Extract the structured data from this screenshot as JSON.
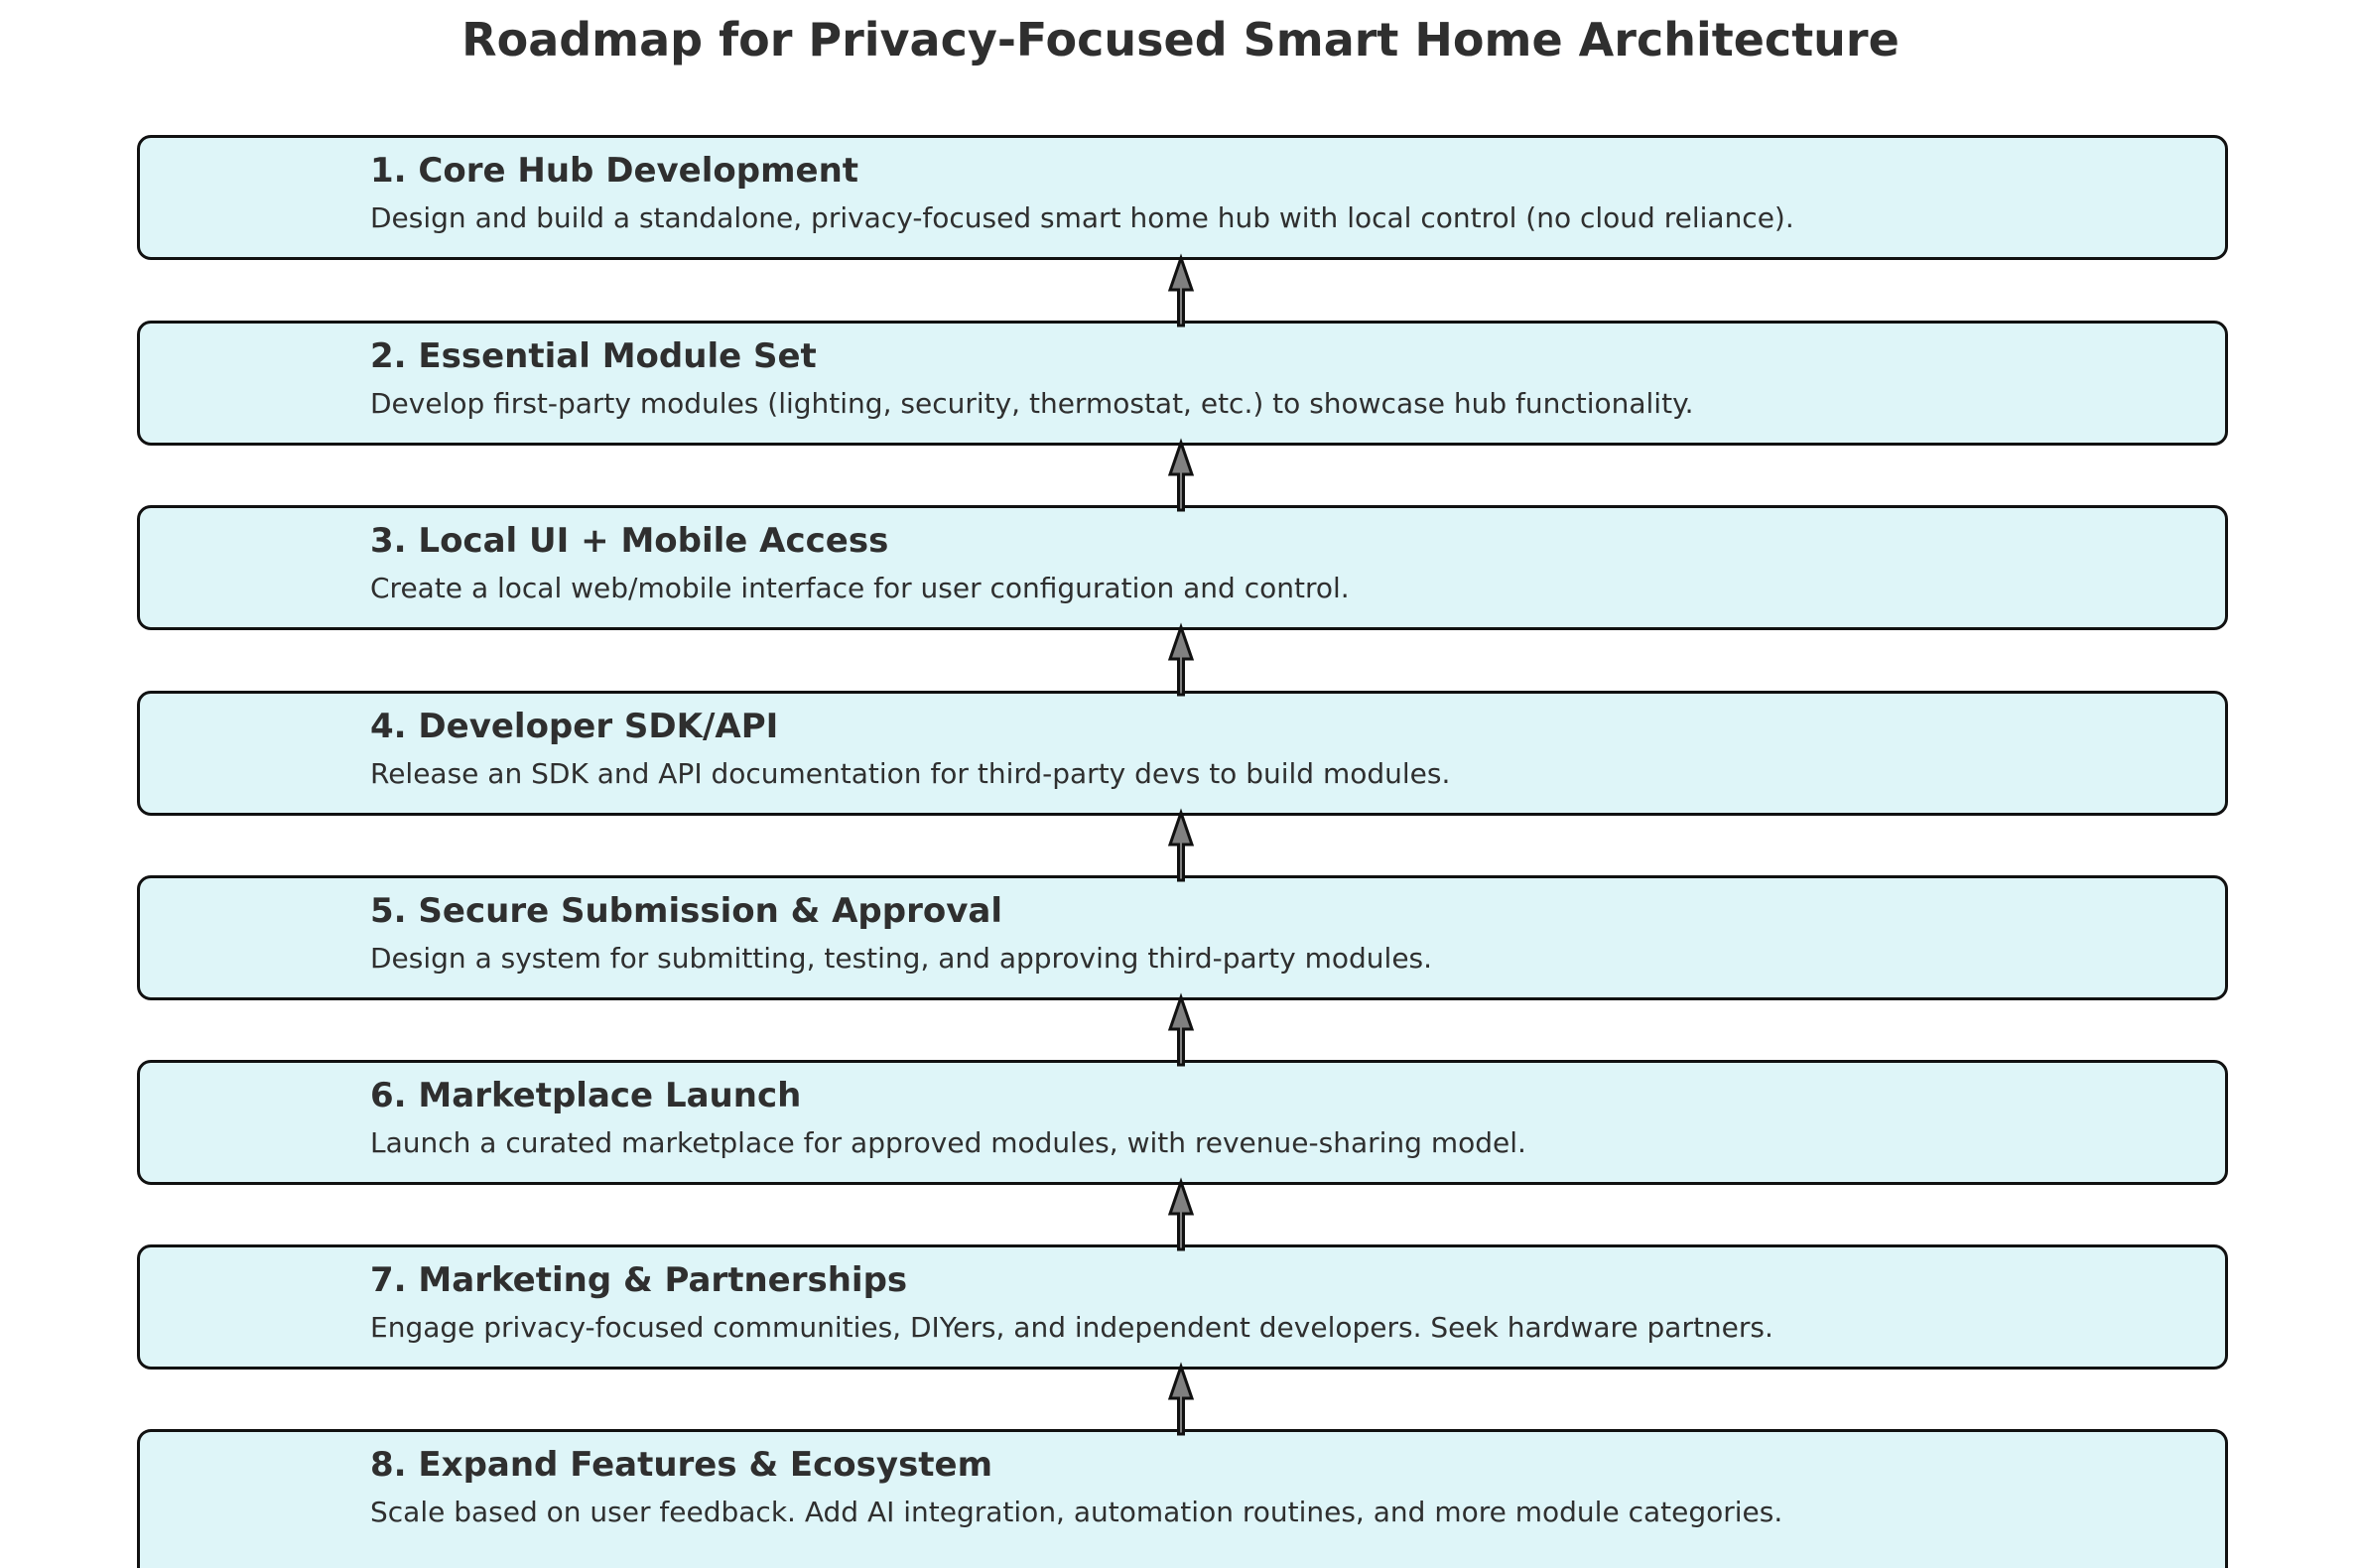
{
  "title": "Roadmap for Privacy-Focused Smart Home Architecture",
  "colors": {
    "box_fill": "#def5f8",
    "box_border": "#111111",
    "arrow_fill": "#808080",
    "text": "#2f2f2f"
  },
  "steps": [
    {
      "title": "1. Core Hub Development",
      "description": "Design and build a standalone, privacy-focused smart home hub with local control (no cloud reliance)."
    },
    {
      "title": "2. Essential Module Set",
      "description": "Develop first-party modules (lighting, security, thermostat, etc.) to showcase hub functionality."
    },
    {
      "title": "3. Local UI + Mobile Access",
      "description": "Create a local web/mobile interface for user configuration and control."
    },
    {
      "title": "4. Developer SDK/API",
      "description": "Release an SDK and API documentation for third-party devs to build modules."
    },
    {
      "title": "5. Secure Submission & Approval",
      "description": "Design a system for submitting, testing, and approving third-party modules."
    },
    {
      "title": "6. Marketplace Launch",
      "description": "Launch a curated marketplace for approved modules, with revenue-sharing model."
    },
    {
      "title": "7. Marketing & Partnerships",
      "description": "Engage privacy-focused communities, DIYers, and independent developers. Seek hardware partners."
    },
    {
      "title": "8. Expand Features & Ecosystem",
      "description": "Scale based on user feedback. Add AI integration, automation routines, and more module categories."
    }
  ],
  "connectors": [
    {
      "from": "2. Essential Module Set",
      "to": "1. Core Hub Development"
    },
    {
      "from": "3. Local UI + Mobile Access",
      "to": "2. Essential Module Set"
    },
    {
      "from": "4. Developer SDK/API",
      "to": "3. Local UI + Mobile Access"
    },
    {
      "from": "5. Secure Submission & Approval",
      "to": "4. Developer SDK/API"
    },
    {
      "from": "6. Marketplace Launch",
      "to": "5. Secure Submission & Approval"
    },
    {
      "from": "7. Marketing & Partnerships",
      "to": "6. Marketplace Launch"
    },
    {
      "from": "8. Expand Features & Ecosystem",
      "to": "7. Marketing & Partnerships"
    }
  ]
}
